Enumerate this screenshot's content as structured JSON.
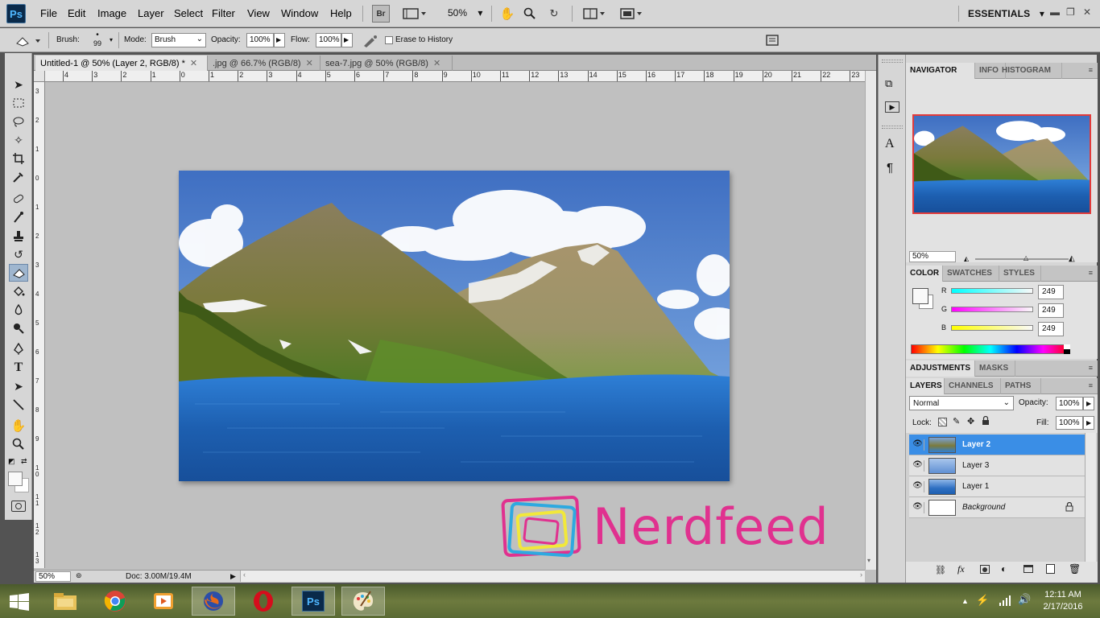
{
  "app": {
    "logo": "Ps"
  },
  "menu": [
    "File",
    "Edit",
    "Image",
    "Layer",
    "Select",
    "Filter",
    "View",
    "Window",
    "Help"
  ],
  "appbar": {
    "bridge": "Br",
    "zoom": "50%",
    "workspace": "ESSENTIALS"
  },
  "options": {
    "brush_label": "Brush:",
    "brush_size": "99",
    "mode_label": "Mode:",
    "mode_value": "Brush",
    "opacity_label": "Opacity:",
    "opacity_value": "100%",
    "flow_label": "Flow:",
    "flow_value": "100%",
    "erase_history_label": "Erase to History"
  },
  "tabs": [
    {
      "label": "Untitled-1 @ 50% (Layer 2, RGB/8) *",
      "active": true
    },
    {
      "label": ".jpg @ 66.7% (RGB/8)",
      "active": false
    },
    {
      "label": "sea-7.jpg @ 50% (RGB/8)",
      "active": false
    }
  ],
  "ruler": {
    "h_labels": [
      "4",
      "3",
      "2",
      "1",
      "0",
      "1",
      "2",
      "3",
      "4",
      "5",
      "6",
      "7",
      "8",
      "9",
      "10",
      "11",
      "12",
      "13",
      "14",
      "15",
      "16",
      "17",
      "18",
      "19",
      "20",
      "21",
      "22",
      "23"
    ],
    "v_labels": [
      "3",
      "2",
      "1",
      "0",
      "1",
      "2",
      "3",
      "4",
      "5",
      "6",
      "7",
      "8",
      "9",
      "1 0",
      "1 1",
      "1 2",
      "1 3"
    ]
  },
  "status": {
    "zoom": "50%",
    "doc": "Doc: 3.00M/19.4M"
  },
  "navigator": {
    "tabs": [
      "NAVIGATOR",
      "INFO",
      "HISTOGRAM"
    ],
    "zoom": "50%"
  },
  "color": {
    "tabs": [
      "COLOR",
      "SWATCHES",
      "STYLES"
    ],
    "r_label": "R",
    "g_label": "G",
    "b_label": "B",
    "r": "249",
    "g": "249",
    "b": "249"
  },
  "adjustments": {
    "tabs": [
      "ADJUSTMENTS",
      "MASKS"
    ]
  },
  "layers": {
    "tabs": [
      "LAYERS",
      "CHANNELS",
      "PATHS"
    ],
    "blend_mode": "Normal",
    "opacity_label": "Opacity:",
    "opacity": "100%",
    "lock_label": "Lock:",
    "fill_label": "Fill:",
    "fill": "100%",
    "items": [
      {
        "name": "Layer 2",
        "selected": true
      },
      {
        "name": "Layer 3",
        "selected": false
      },
      {
        "name": "Layer 1",
        "selected": false
      },
      {
        "name": "Background",
        "selected": false
      }
    ]
  },
  "watermark": {
    "text": "Nerdfeed"
  },
  "taskbar": {
    "time": "12:11 AM",
    "date": "2/17/2016"
  },
  "colors": {
    "accent": "#3a8ee6",
    "brand": "#e0318f"
  }
}
